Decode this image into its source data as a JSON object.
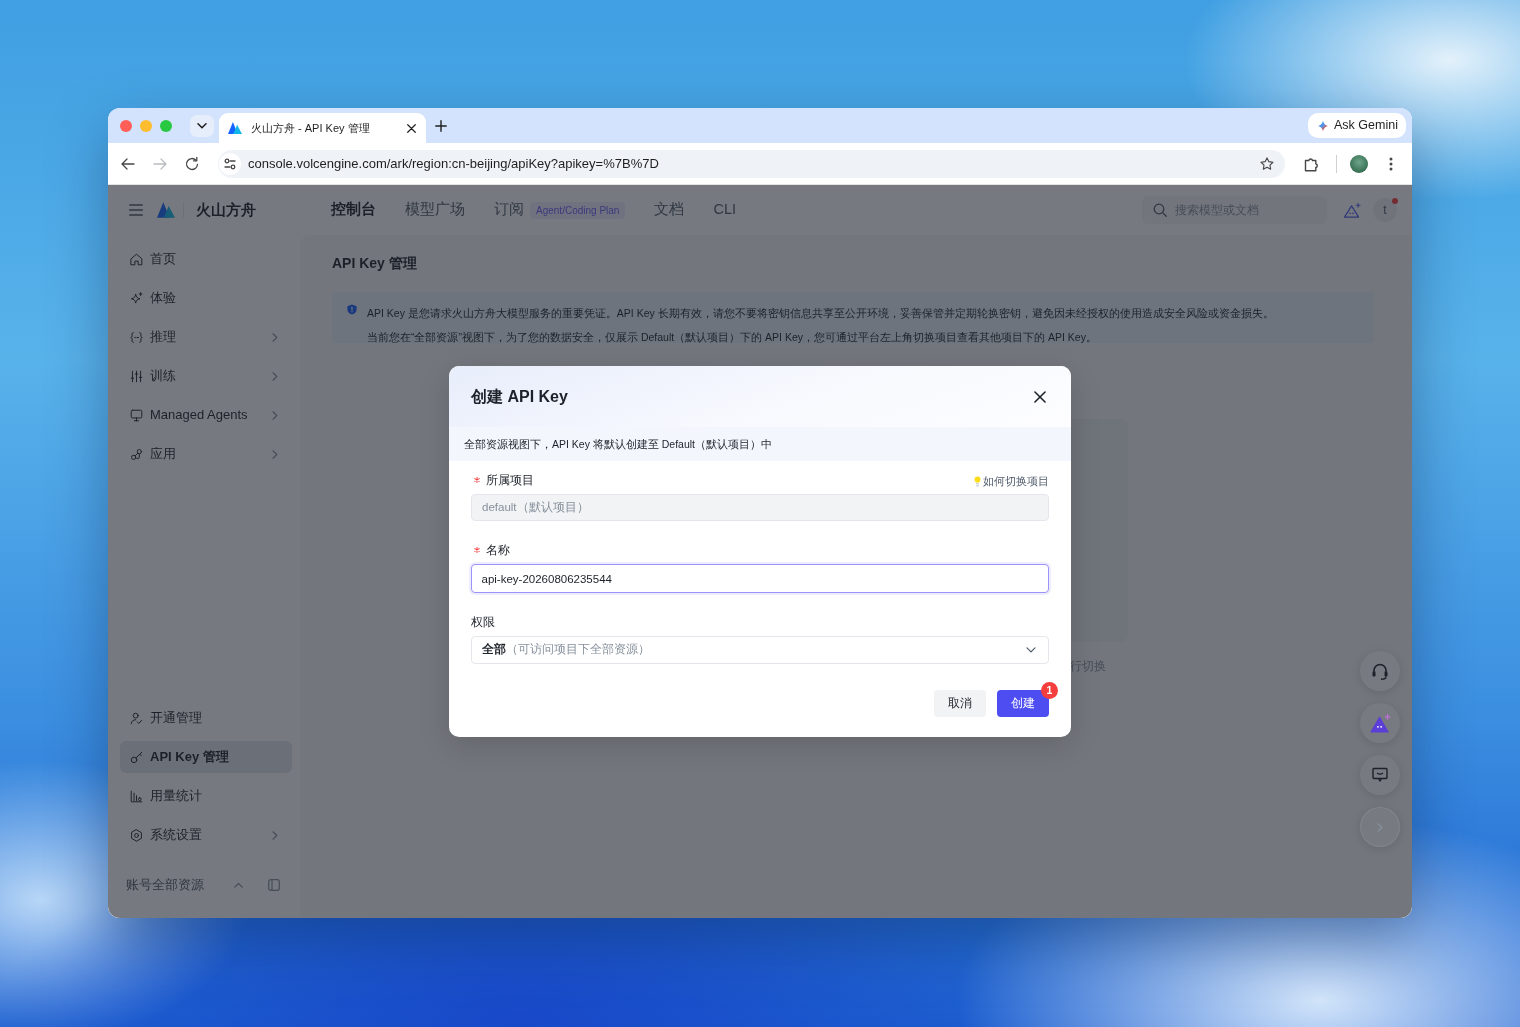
{
  "browser": {
    "tabs": [
      {
        "title": "火山方舟 - API Key 管理",
        "selected": true
      }
    ],
    "gemini_button": "Ask Gemini",
    "nav_buttons": [
      {
        "kind": "back",
        "disabled": false
      },
      {
        "kind": "forward",
        "disabled": true
      },
      {
        "kind": "reload",
        "disabled": false
      }
    ],
    "url": "console.volcengine.com/ark/region:cn-beijing/apiKey?apikey=%7B%7D"
  },
  "header": {
    "brand": "火山方舟",
    "nav": [
      {
        "label": "控制台",
        "selected": true
      },
      {
        "label": "模型广场",
        "selected": false
      },
      {
        "label": "订阅",
        "selected": false,
        "tag": "Agent/Coding Plan"
      },
      {
        "label": "文档",
        "selected": false
      },
      {
        "label": "CLI",
        "selected": false
      }
    ],
    "search": {
      "placeholder": "搜索模型或文档"
    },
    "avatar": {
      "initial": "t",
      "has_notification": true
    }
  },
  "sidebar": {
    "items": [
      {
        "label": "首页",
        "kind": "link",
        "selected": false
      },
      {
        "label": "体验",
        "kind": "link",
        "selected": false
      },
      {
        "label": "推理",
        "kind": "group",
        "selected": false
      },
      {
        "label": "训练",
        "kind": "group",
        "selected": false
      },
      {
        "label": "Managed Agents",
        "kind": "group",
        "selected": false
      },
      {
        "label": "应用",
        "kind": "group",
        "selected": false
      }
    ],
    "bottom_items": [
      {
        "label": "开通管理",
        "kind": "link",
        "selected": false
      },
      {
        "label": "API Key 管理",
        "kind": "link",
        "selected": true
      },
      {
        "label": "用量统计",
        "kind": "link",
        "selected": false
      },
      {
        "label": "系统设置",
        "kind": "group",
        "selected": false
      }
    ],
    "footer": {
      "label": "账号全部资源"
    }
  },
  "page": {
    "title": "API Key 管理",
    "notice": [
      "API Key 是您请求火山方舟大模型服务的重要凭证。API Key 长期有效，请您不要将密钥信息共享至公开环境，妥善保管并定期轮换密钥，避免因未经授权的使用造成安全风险或资金损失。",
      "当前您在“全部资源”视图下，为了您的数据安全，仅展示 Default（默认项目）下的 API Key，您可通过平台左上角切换项目查看其他项目下的 API Key。"
    ],
    "partial_text": "行切换"
  },
  "dialog": {
    "title": "创建 API Key",
    "notice": "全部资源视图下，API Key 将默认创建至 Default（默认项目）中",
    "fields": [
      {
        "kind": "text",
        "label": "所属项目",
        "required": true,
        "help": "如何切换项目",
        "value": "default（默认项目）",
        "disabled": true,
        "focused": false
      },
      {
        "kind": "text",
        "label": "名称",
        "required": true,
        "value": "api-key-20260806235544",
        "disabled": false,
        "focused": true
      },
      {
        "kind": "select",
        "label": "权限",
        "required": false,
        "value": "全部",
        "hint": "（可访问项目下全部资源）",
        "disabled": false,
        "focused": false
      }
    ],
    "buttons": [
      {
        "label": "取消",
        "kind": "secondary"
      },
      {
        "label": "创建",
        "kind": "primary",
        "badge": "1"
      }
    ]
  }
}
